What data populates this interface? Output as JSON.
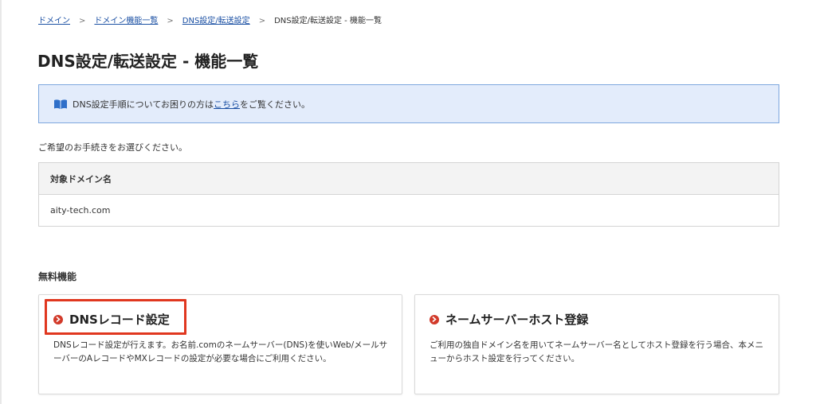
{
  "breadcrumb": {
    "items": [
      "ドメイン",
      "ドメイン機能一覧",
      "DNS設定/転送設定"
    ],
    "current": "DNS設定/転送設定 - 機能一覧",
    "separator": ">"
  },
  "page": {
    "title": "DNS設定/転送設定 - 機能一覧"
  },
  "info": {
    "prefix": "DNS設定手順についてお困りの方は",
    "link": "こちら",
    "suffix": "をご覧ください。",
    "icon": "book-icon"
  },
  "instruction": "ご希望のお手続きをお選びください。",
  "domain_table": {
    "header": "対象ドメイン名",
    "value": "aity-tech.com"
  },
  "section": {
    "title": "無料機能"
  },
  "cards": [
    {
      "title": "DNSレコード設定",
      "description": "DNSレコード設定が行えます。お名前.comのネームサーバー(DNS)を使いWeb/メールサーバーのAレコードやMXレコードの設定が必要な場合にご利用ください。"
    },
    {
      "title": "ネームサーバーホスト登録",
      "description": "ご利用の独自ドメイン名を用いてネームサーバー名としてホスト登録を行う場合、本メニューからホスト設定を行ってください。"
    }
  ],
  "colors": {
    "link": "#1a4fa3",
    "info_bg": "#e3ecfb",
    "info_border": "#7ea7de",
    "accent_red": "#d23a2a",
    "highlight": "#e0371f"
  }
}
